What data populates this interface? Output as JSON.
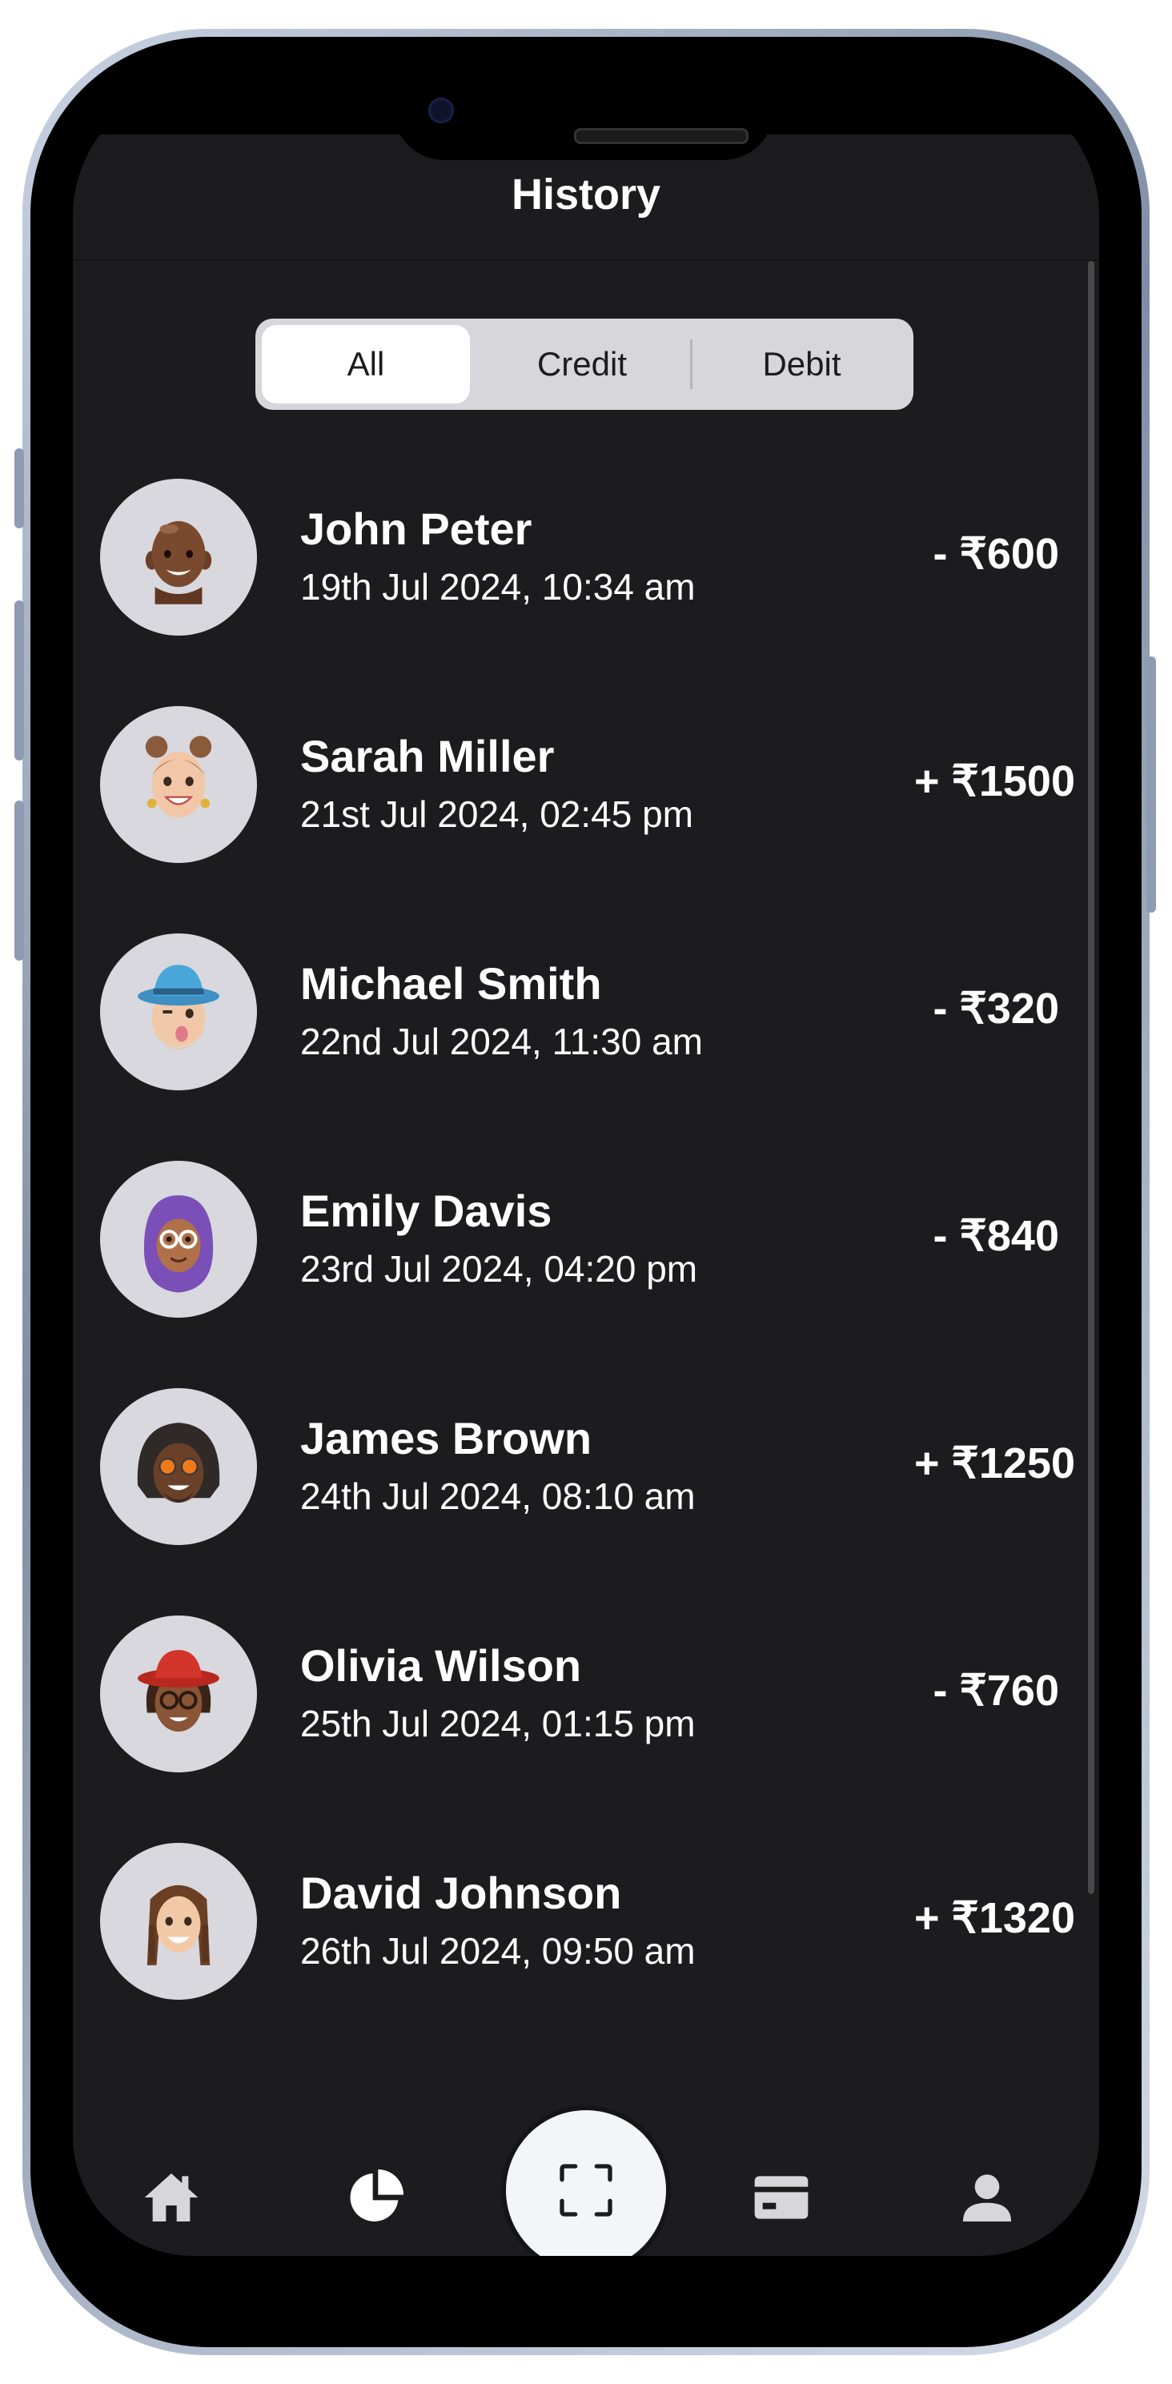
{
  "screen": {
    "title": "History"
  },
  "filter": {
    "tabs": [
      "All",
      "Credit",
      "Debit"
    ],
    "selected": "All"
  },
  "transactions": [
    {
      "name": "John Peter",
      "datetime": "19th Jul 2024, 10:34 am",
      "amount": "- ₹600",
      "type": "debit",
      "avatar_icon": "memoji-bald-man-icon"
    },
    {
      "name": "Sarah Miller",
      "datetime": "21st Jul 2024, 02:45 pm",
      "amount": "+ ₹1500",
      "type": "credit",
      "avatar_icon": "memoji-woman-buns-icon"
    },
    {
      "name": "Michael Smith",
      "datetime": "22nd Jul 2024, 11:30 am",
      "amount": "- ₹320",
      "type": "debit",
      "avatar_icon": "memoji-man-blue-hat-icon"
    },
    {
      "name": "Emily Davis",
      "datetime": "23rd Jul 2024, 04:20 pm",
      "amount": "- ₹840",
      "type": "debit",
      "avatar_icon": "memoji-woman-hijab-icon"
    },
    {
      "name": "James Brown",
      "datetime": "24th Jul 2024, 08:10 am",
      "amount": "+ ₹1250",
      "type": "credit",
      "avatar_icon": "memoji-man-dreadlocks-icon"
    },
    {
      "name": "Olivia Wilson",
      "datetime": "25th Jul 2024, 01:15 pm",
      "amount": "- ₹760",
      "type": "debit",
      "avatar_icon": "memoji-woman-red-hat-icon"
    },
    {
      "name": "David Johnson",
      "datetime": "26th Jul 2024, 09:50 am",
      "amount": "+ ₹1320",
      "type": "credit",
      "avatar_icon": "memoji-man-braids-icon"
    }
  ],
  "bottom_nav": {
    "items": [
      {
        "icon": "home-icon"
      },
      {
        "icon": "pie-chart-icon"
      },
      {
        "icon": "scan-icon"
      },
      {
        "icon": "card-icon"
      },
      {
        "icon": "profile-icon"
      }
    ]
  },
  "colors": {
    "background": "#1c1c1e",
    "text": "#ffffff",
    "segment_bg": "#d6d6db",
    "segment_active": "#ffffff",
    "avatar_bg": "#d8d8de",
    "nav_icon": "#d6d6db",
    "scan_button_bg": "#f4f5f7"
  }
}
